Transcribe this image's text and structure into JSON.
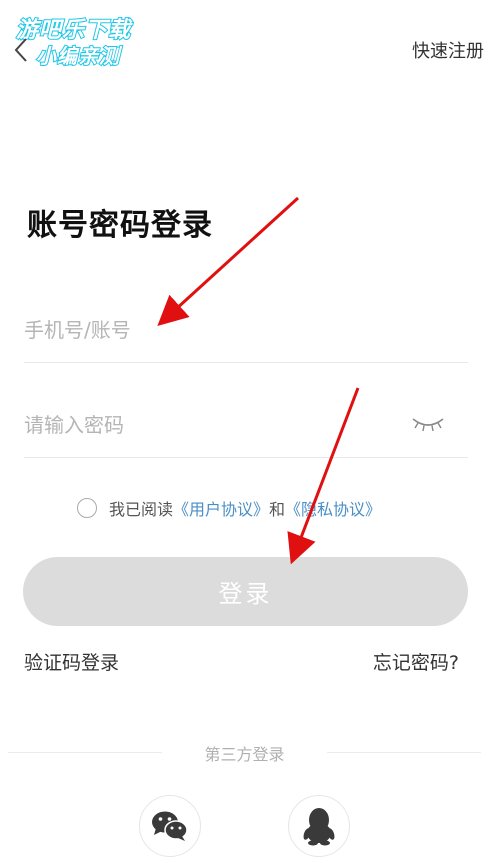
{
  "watermark": {
    "line1": "游吧乐下载",
    "line2": "小编亲测"
  },
  "header": {
    "quick_register": "快速注册"
  },
  "title": "账号密码登录",
  "form": {
    "account_placeholder": "手机号/账号",
    "password_placeholder": "请输入密码"
  },
  "agreement": {
    "prefix": "我已阅读",
    "user_agreement": "《用户协议》",
    "conjunction": "和",
    "privacy_policy": "《隐私协议》"
  },
  "login_button": "登录",
  "links": {
    "sms_login": "验证码登录",
    "forgot_password": "忘记密码?"
  },
  "third_party": {
    "label": "第三方登录"
  },
  "colors": {
    "accent_link": "#4a8ec8",
    "button_disabled": "#dcdcdc",
    "annotation_arrow": "#e01010",
    "watermark_stroke": "#1ec7e8"
  }
}
